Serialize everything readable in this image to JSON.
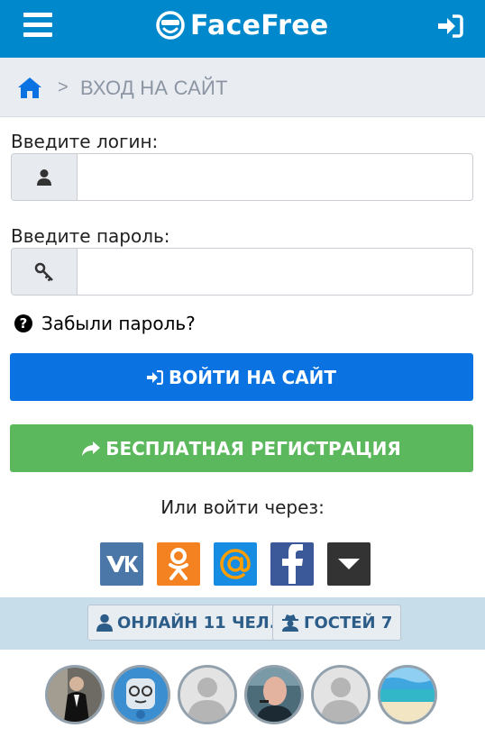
{
  "header": {
    "brand": "FaceFree",
    "background_color": "#0088cc",
    "menu_icon": "hamburger-icon",
    "login_icon": "sign-in-icon"
  },
  "breadcrumb": {
    "home_icon": "home-icon",
    "separator": ">",
    "title": "ВХОД НА САЙТ"
  },
  "form": {
    "login_label": "Введите логин:",
    "login_value": "",
    "login_icon": "user-icon",
    "password_label": "Введите пароль:",
    "password_value": "",
    "password_icon": "key-icon",
    "forgot_label": "Забыли пароль?",
    "login_button": "ВОЙТИ НА САЙТ",
    "register_button": "БЕСПЛАТНАЯ РЕГИСТРАЦИЯ",
    "or_label": "Или войти через:",
    "colors": {
      "login": "#0b72e2",
      "register": "#5cb85c"
    }
  },
  "social": [
    {
      "name": "vk",
      "icon": "vk-icon",
      "color": "#4a76a8"
    },
    {
      "name": "odnoklassniki",
      "icon": "ok-icon",
      "color": "#f58220"
    },
    {
      "name": "mail.ru",
      "icon": "at-icon",
      "color": "#168de2"
    },
    {
      "name": "facebook",
      "icon": "facebook-icon",
      "color": "#3b5998"
    },
    {
      "name": "more",
      "icon": "caret-down-icon",
      "color": "#333333"
    }
  ],
  "online": {
    "online_label": "ОНЛАЙН 11 ЧЕЛ.",
    "guests_label": "ГОСТЕЙ 7"
  },
  "avatars": [
    "user-avatar-1",
    "user-avatar-2",
    "user-avatar-3",
    "user-avatar-4",
    "user-avatar-5",
    "user-avatar-6"
  ]
}
